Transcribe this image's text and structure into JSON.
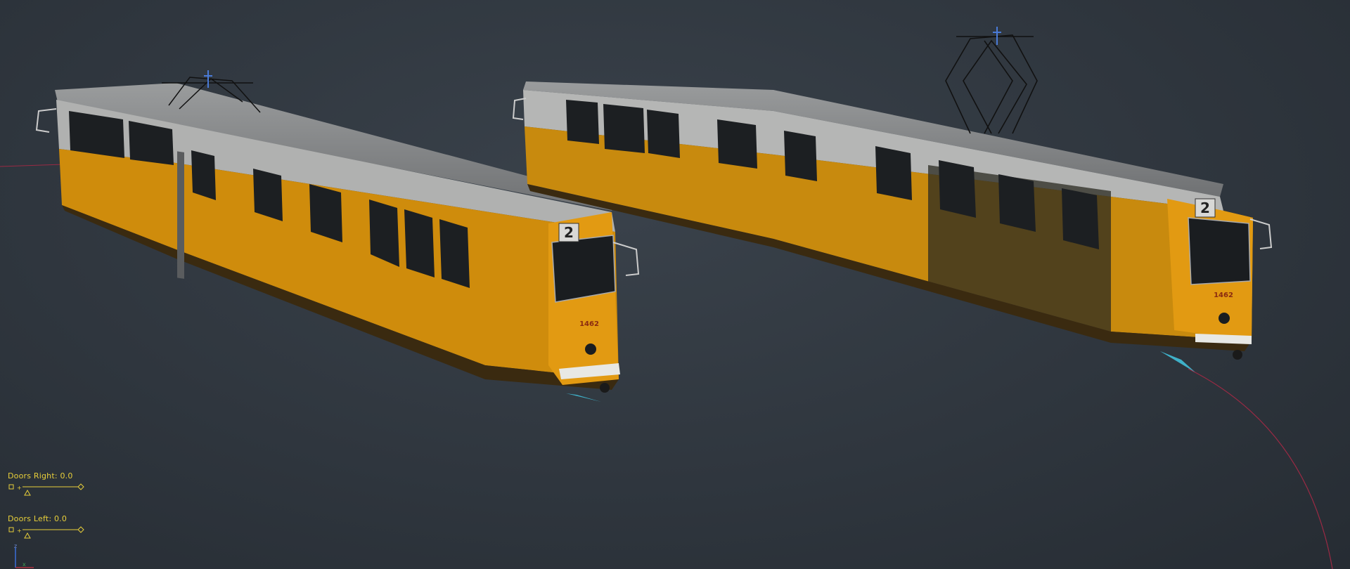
{
  "viewport": {
    "background": "#2f363e",
    "accent_label_color": "#e8cf3a",
    "tram_body_color": "#e29a12",
    "tram_roof_color": "#8d8f90",
    "tram_window_color": "#1a1d20"
  },
  "trams": [
    {
      "name": "tram-left",
      "route_number": "2",
      "fleet_number": "1462"
    },
    {
      "name": "tram-right",
      "route_number": "2",
      "fleet_number": "1462"
    }
  ],
  "sliders": [
    {
      "label": "Doors Right: 0.0",
      "value": 0.0
    },
    {
      "label": "Doors Left: 0.0",
      "value": 0.0
    }
  ],
  "axis_gizmo": {
    "z_label": "z",
    "x_label": "x"
  }
}
